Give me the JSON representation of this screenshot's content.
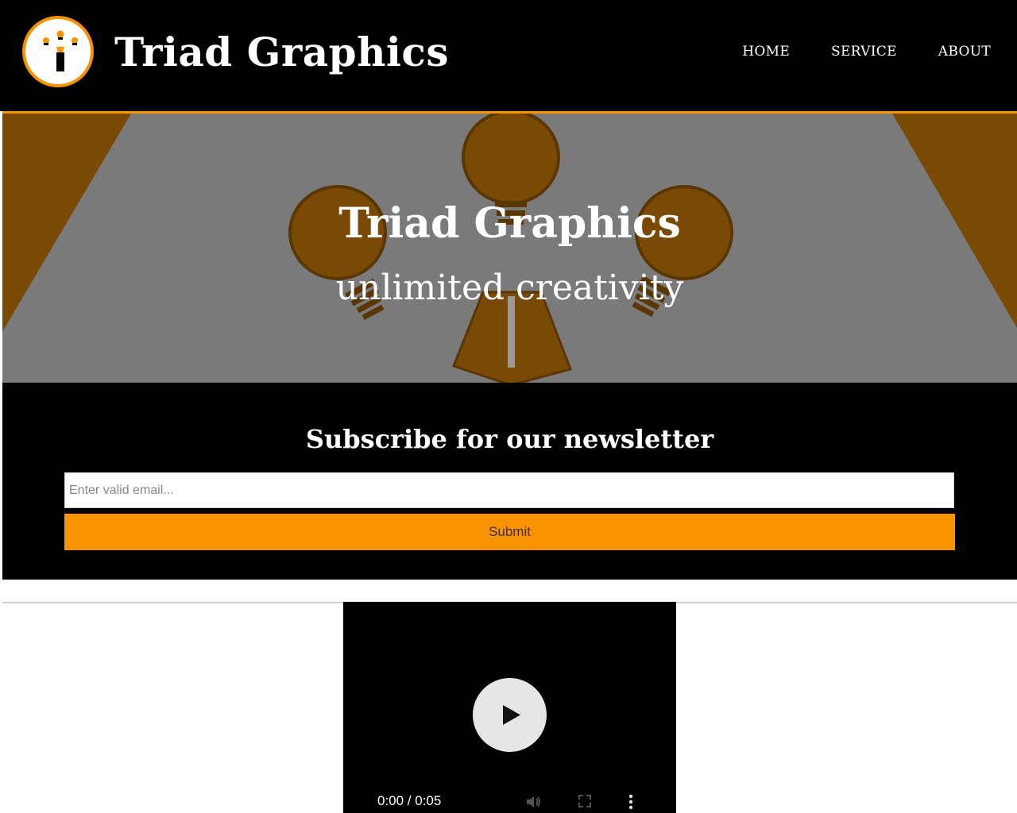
{
  "header": {
    "brand": "Triad Graphics",
    "logo_icon": "lightbulb-logo-icon",
    "nav": [
      {
        "label": "HOME"
      },
      {
        "label": "SERVICE"
      },
      {
        "label": "ABOUT"
      }
    ]
  },
  "hero": {
    "title": "Triad Graphics",
    "subtitle": "unlimited creativity",
    "image": "three-lightbulbs-illustration"
  },
  "newsletter": {
    "title": "Subscribe for our newsletter",
    "email_placeholder": "Enter valid email...",
    "submit_label": "Submit"
  },
  "video": {
    "time": "0:00 / 0:05",
    "play_icon": "play-icon",
    "volume_icon": "volume-icon",
    "fullscreen_icon": "fullscreen-icon",
    "more_icon": "more-options-icon"
  },
  "colors": {
    "accent": "#f59300",
    "button": "#fb9300",
    "header_bg": "#000000",
    "hero_bg": "#7a7a7a",
    "bulb_brown": "#7a4a05"
  }
}
